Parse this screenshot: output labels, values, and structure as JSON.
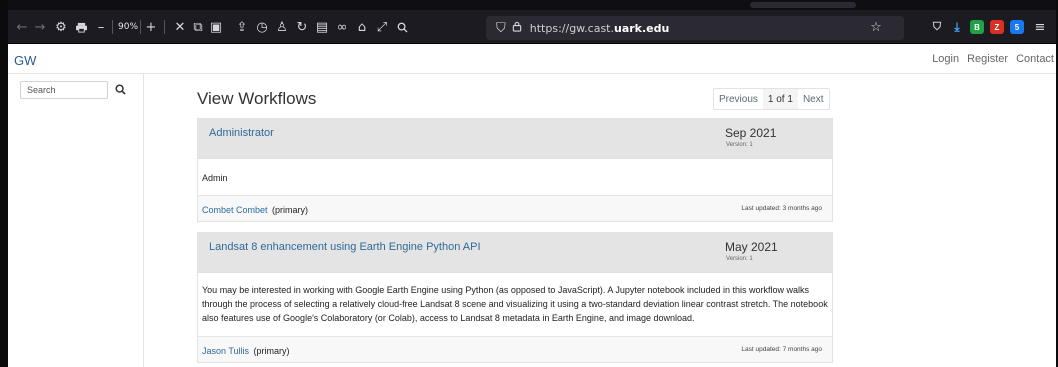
{
  "browser": {
    "zoom": "90%",
    "url_prefix": "https://gw.cast.",
    "url_domain": "uark.edu",
    "extensions": [
      {
        "name": "pocket-icon",
        "color": "#c9c9cf"
      },
      {
        "name": "download-icon",
        "color": "#3ea8ff"
      },
      {
        "name": "b-extension-icon",
        "color": "#22a045",
        "text": "B"
      },
      {
        "name": "red-extension-icon",
        "color": "#d93025",
        "text": "Z"
      },
      {
        "name": "puzzle-icon",
        "color": "#1877f2",
        "text": "5"
      }
    ]
  },
  "site": {
    "brand": "GW",
    "nav": [
      "Login",
      "Register",
      "Contact"
    ]
  },
  "search": {
    "placeholder": "Search"
  },
  "main": {
    "title": "View Workflows",
    "pager": {
      "previous": "Previous",
      "current": "1 of 1",
      "next": "Next"
    }
  },
  "workflows": [
    {
      "title": "Administrator",
      "date": "Sep 2021",
      "version": "Version: 1",
      "description": "Admin",
      "author": "Combet Combet",
      "role": "(primary)",
      "updated": "Last updated: 3 months ago"
    },
    {
      "title": "Landsat 8 enhancement using Earth Engine Python API",
      "date": "May 2021",
      "version": "Version: 1",
      "description": "You may be interested in working with Google Earth Engine using Python (as opposed to JavaScript). A Jupyter notebook included in this workflow walks through the process of selecting a relatively cloud-free Landsat 8 scene and visualizing it using a two-standard deviation linear contrast stretch. The notebook also features use of Google's Colaboratory (or Colab), access to Landsat 8 metadata in Earth Engine, and image download.",
      "author": "Jason Tullis",
      "role": "(primary)",
      "updated": "Last updated: 7 months ago"
    }
  ]
}
